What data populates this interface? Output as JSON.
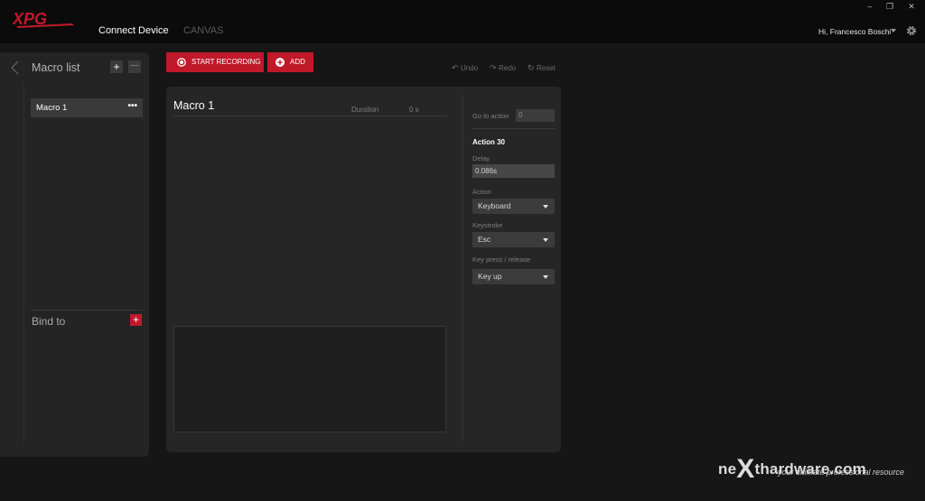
{
  "app": {
    "logo_text": "XPG",
    "nav": {
      "connect_device": "Connect Device",
      "canvas": "CANVAS"
    },
    "window_controls": {
      "minimize": "–",
      "maximize": "❐",
      "close": "✕"
    },
    "user_greeting": "Hi, Francesco Boschi",
    "accent_color": "#c0192a"
  },
  "sidebar": {
    "title": "Macro list",
    "add_label": "+",
    "more_label": "···",
    "items": [
      {
        "label": "Macro 1",
        "more": "•••"
      }
    ],
    "bind_title": "Bind to",
    "bind_add_label": "+"
  },
  "toolbar": {
    "record_label": "START RECORDING",
    "add_label": "ADD",
    "undo_label": "Undo",
    "redo_label": "Redo",
    "reset_label": "Reset"
  },
  "macro": {
    "name": "Macro 1",
    "duration_label": "Duration",
    "duration_value": "0 s"
  },
  "properties": {
    "goto_label": "Go to action",
    "goto_value": "0",
    "action_title": "Action 30",
    "delay_label": "Delay",
    "delay_value": "0.086s",
    "action_label": "Action",
    "action_value": "Keyboard",
    "keystroke_label": "Keystroke",
    "keystroke_value": "Esc",
    "keypress_label": "Key press / release",
    "keypress_value": "Key up"
  },
  "watermark": {
    "brand_prefix": "ne",
    "brand_x": "X",
    "brand_suffix": "thardware.com",
    "tagline": "your ultimate professional resource"
  }
}
